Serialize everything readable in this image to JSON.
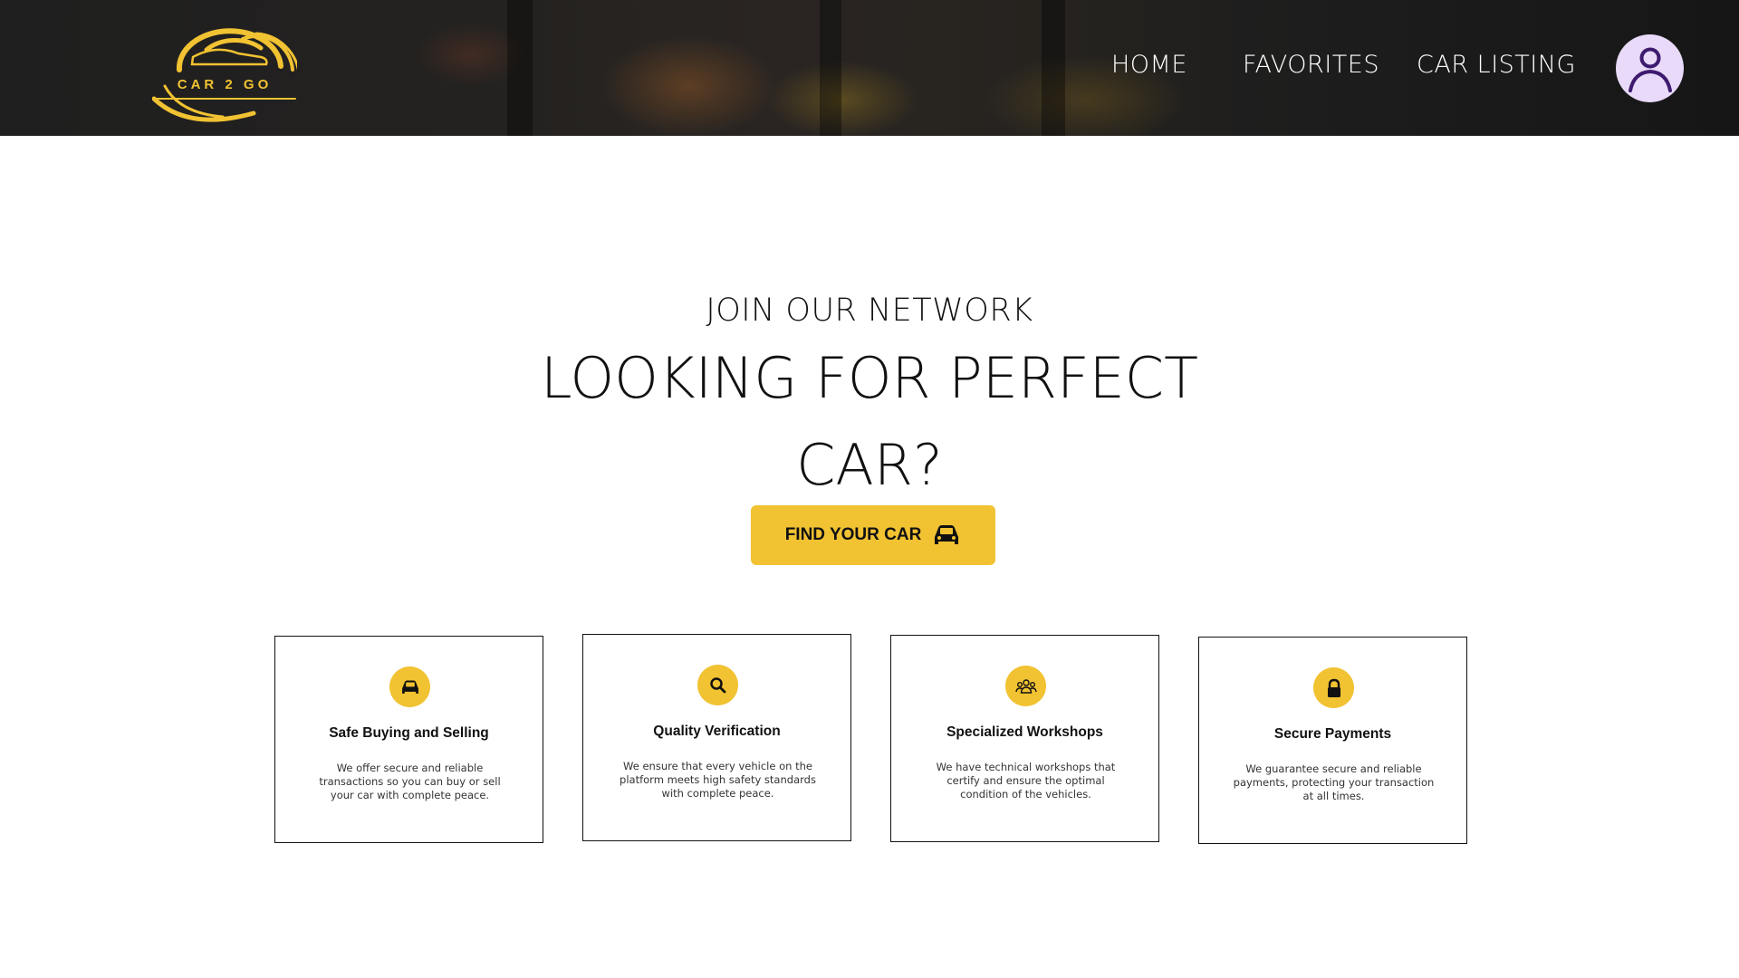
{
  "header": {
    "logo_text": "CAR 2 GO",
    "nav": [
      {
        "label": "HOME"
      },
      {
        "label": "FAVORITES"
      },
      {
        "label": "CAR LISTING"
      }
    ],
    "avatar_icon": "user-icon"
  },
  "hero": {
    "eyebrow": "JOIN OUR NETWORK",
    "headline": "LOOKING FOR PERFECT CAR?",
    "cta_label": "FIND YOUR CAR",
    "cta_icon": "car-icon"
  },
  "features": [
    {
      "icon": "car-icon",
      "title": "Safe Buying and Selling",
      "description": "We offer secure and reliable transactions so you can buy or sell your car with complete peace."
    },
    {
      "icon": "search-icon",
      "title": "Quality Verification",
      "description": "We ensure that every vehicle on the platform meets high safety standards with complete peace."
    },
    {
      "icon": "group-icon",
      "title": "Specialized Workshops",
      "description": "We have technical workshops that certify and ensure the optimal condition of the vehicles."
    },
    {
      "icon": "lock-icon",
      "title": "Secure Payments",
      "description": "We guarantee secure and reliable payments, protecting your transaction at all times."
    }
  ],
  "colors": {
    "accent": "#f1c232",
    "header_bg": "#1f1f1f",
    "avatar_bg": "#e8daf8",
    "avatar_icon": "#3d1a6e"
  }
}
